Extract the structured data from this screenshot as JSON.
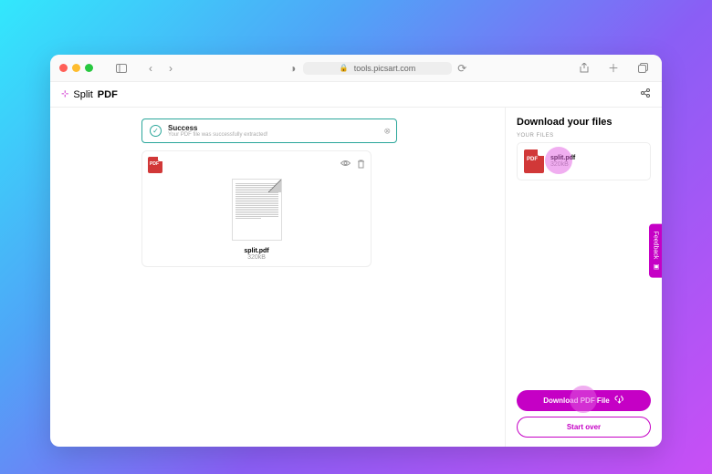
{
  "browser": {
    "url": "tools.picsart.com"
  },
  "app": {
    "brand_prefix": "Split",
    "brand_bold": "PDF"
  },
  "success": {
    "title": "Success",
    "sub": "Your PDF file was successfully extracted!"
  },
  "preview": {
    "filename": "split.pdf",
    "size": "320kB"
  },
  "panel": {
    "heading": "Download your files",
    "label": "YOUR FILES",
    "file": {
      "name": "split.pdf",
      "size": "320kB"
    },
    "download_btn": "Download PDF File",
    "start_over": "Start over"
  },
  "feedback": {
    "label": "Feedback"
  }
}
